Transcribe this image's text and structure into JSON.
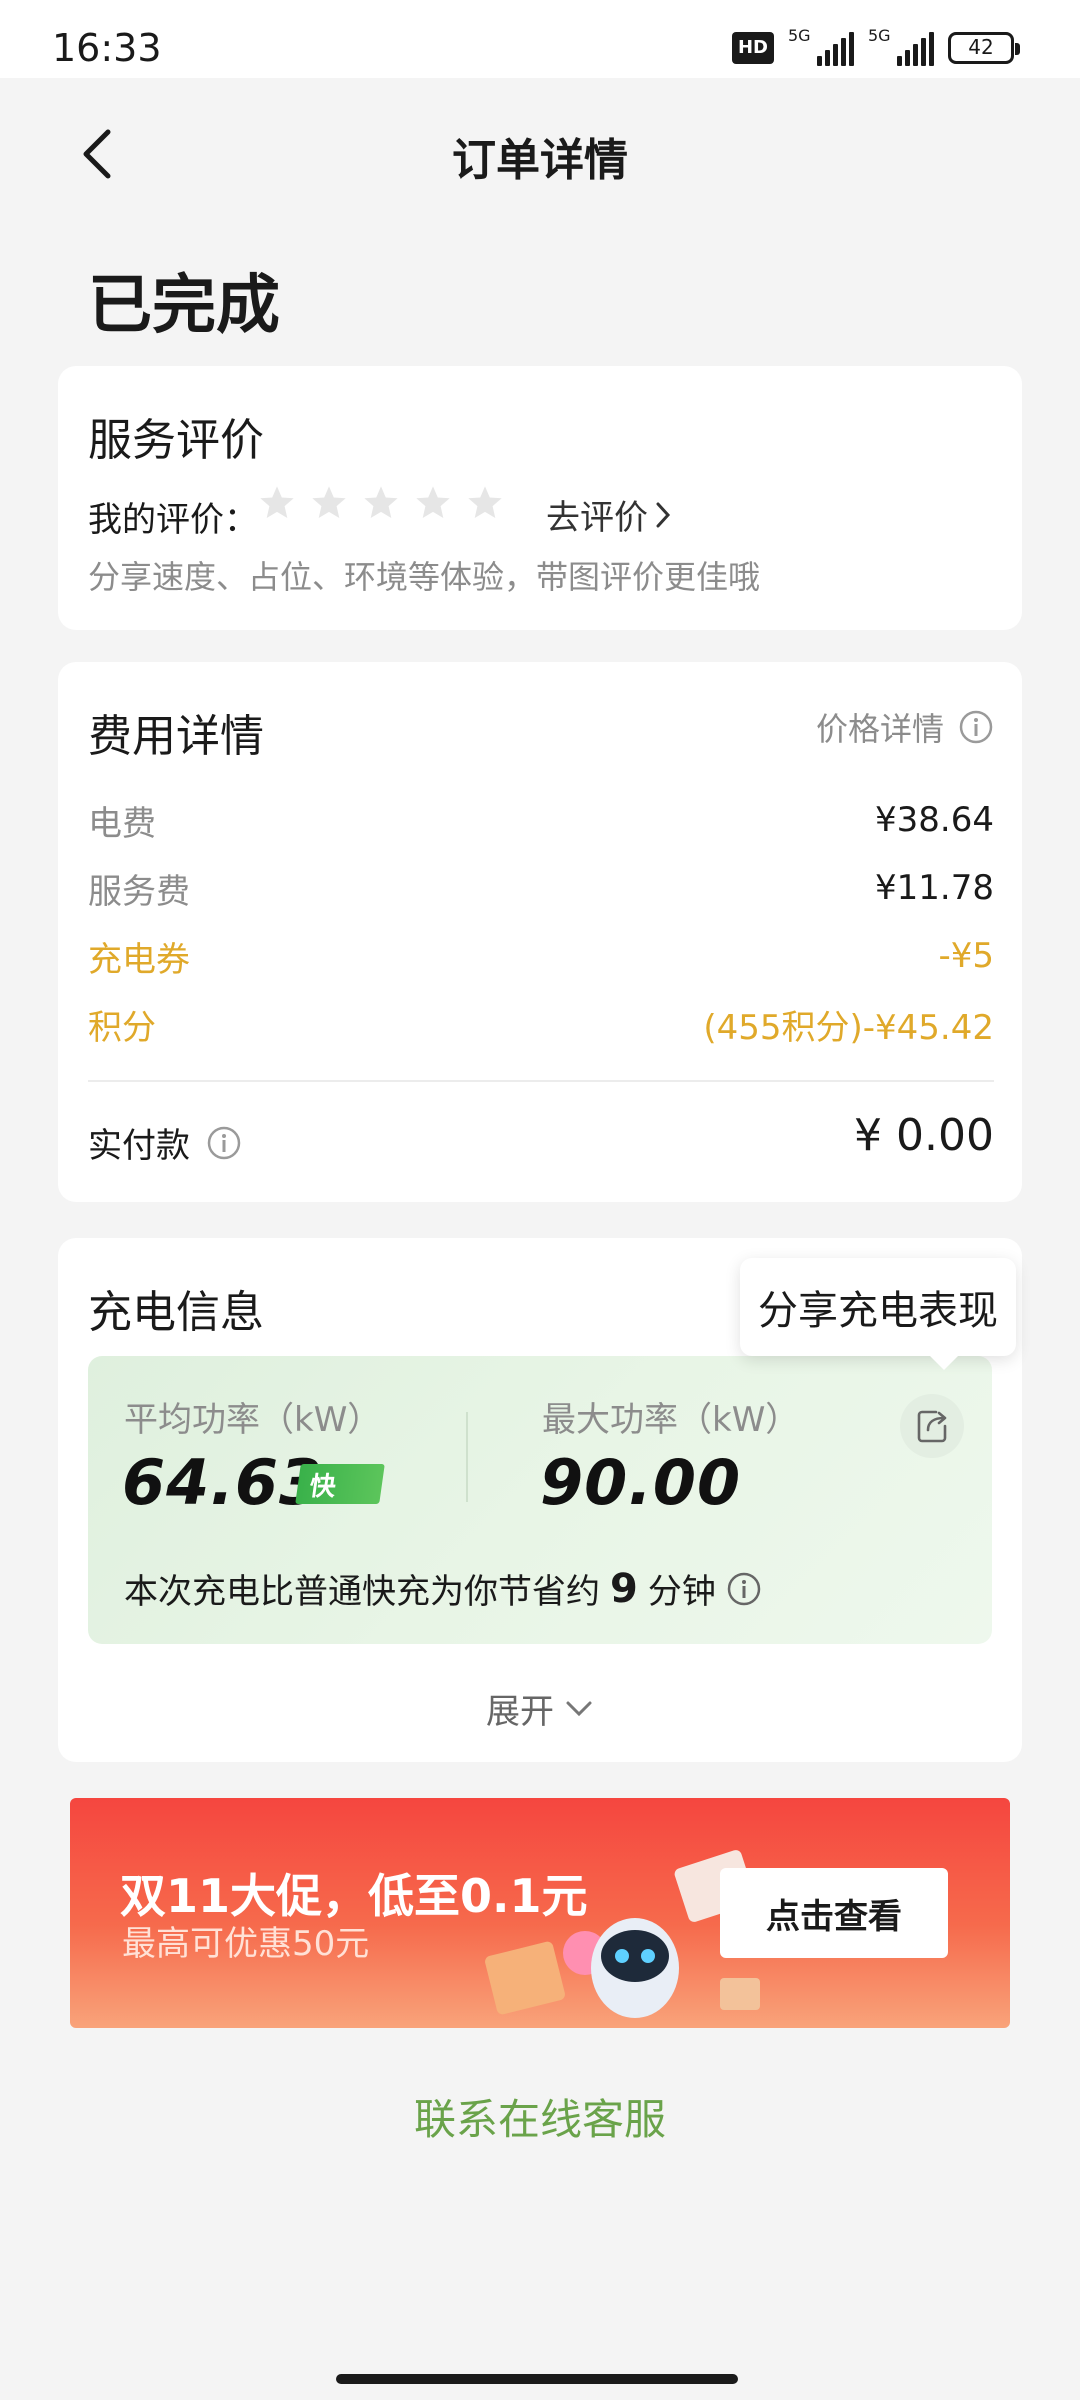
{
  "status_bar": {
    "time": "16:33",
    "hd": "HD",
    "net1": "5G",
    "net2": "5G",
    "battery": "42"
  },
  "header": {
    "title": "订单详情",
    "back_icon": "chevron-left-icon"
  },
  "order": {
    "status": "已完成"
  },
  "review": {
    "title": "服务评价",
    "my_rating_label": "我的评价：",
    "stars_filled": 0,
    "stars_total": 5,
    "go_review": "去评价",
    "hint": "分享速度、占位、环境等体验，带图评价更佳哦"
  },
  "fees": {
    "title": "费用详情",
    "price_detail": "价格详情",
    "rows": [
      {
        "label": "电费",
        "value": "¥38.64"
      },
      {
        "label": "服务费",
        "value": "¥11.78"
      },
      {
        "label": "充电券",
        "value": "-¥5"
      },
      {
        "label": "积分",
        "value": "(455积分)-¥45.42"
      }
    ],
    "paid_label": "实付款",
    "paid_value": "¥ 0.00",
    "accent_color": "#e0a92a"
  },
  "charging": {
    "title": "充电信息",
    "tooltip": "分享充电表现",
    "avg_label": "平均功率（kW）",
    "avg_value": "64.63",
    "fast_badge": "快",
    "max_label": "最大功率（kW）",
    "max_value": "90.00",
    "save_prefix": "本次充电比普通快充为你节省约",
    "save_minutes": "9",
    "save_suffix": "分钟",
    "expand": "展开"
  },
  "banner": {
    "title": "双11大促，低至0.1元",
    "subtitle": "最高可优惠50元",
    "cta": "点击查看",
    "color": "#f5463f"
  },
  "footer": {
    "contact": "联系在线客服",
    "contact_color": "#6aa34a"
  }
}
